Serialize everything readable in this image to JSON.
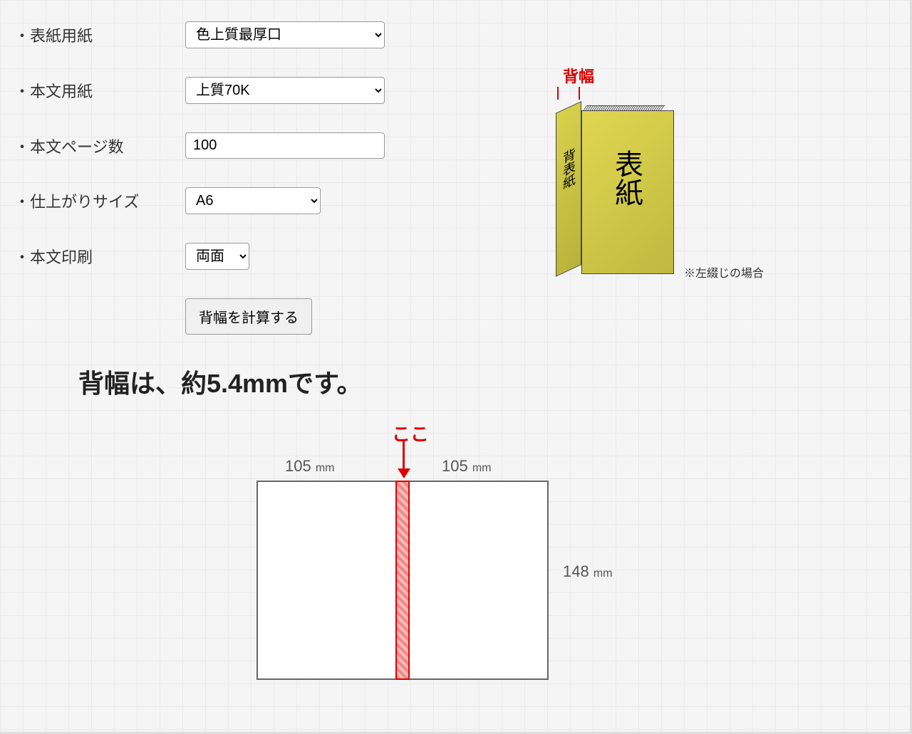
{
  "form": {
    "labels": {
      "cover_paper": "表紙用紙",
      "body_paper": "本文用紙",
      "page_count": "本文ページ数",
      "finish_size": "仕上がりサイズ",
      "body_print": "本文印刷"
    },
    "values": {
      "cover_paper": "色上質最厚口",
      "body_paper": "上質70K",
      "page_count": "100",
      "finish_size": "A6",
      "body_print": "両面"
    },
    "submit_label": "背幅を計算する"
  },
  "result": "背幅は、約5.4mmです。",
  "book_diagram": {
    "title": "背幅",
    "spine_label": "背表紙",
    "front_label": "表紙",
    "note": "※左綴じの場合"
  },
  "spread_diagram": {
    "koko_label": "ここ",
    "width_left": "105",
    "width_right": "105",
    "width_unit": "mm",
    "height": "148",
    "height_unit": "mm"
  }
}
